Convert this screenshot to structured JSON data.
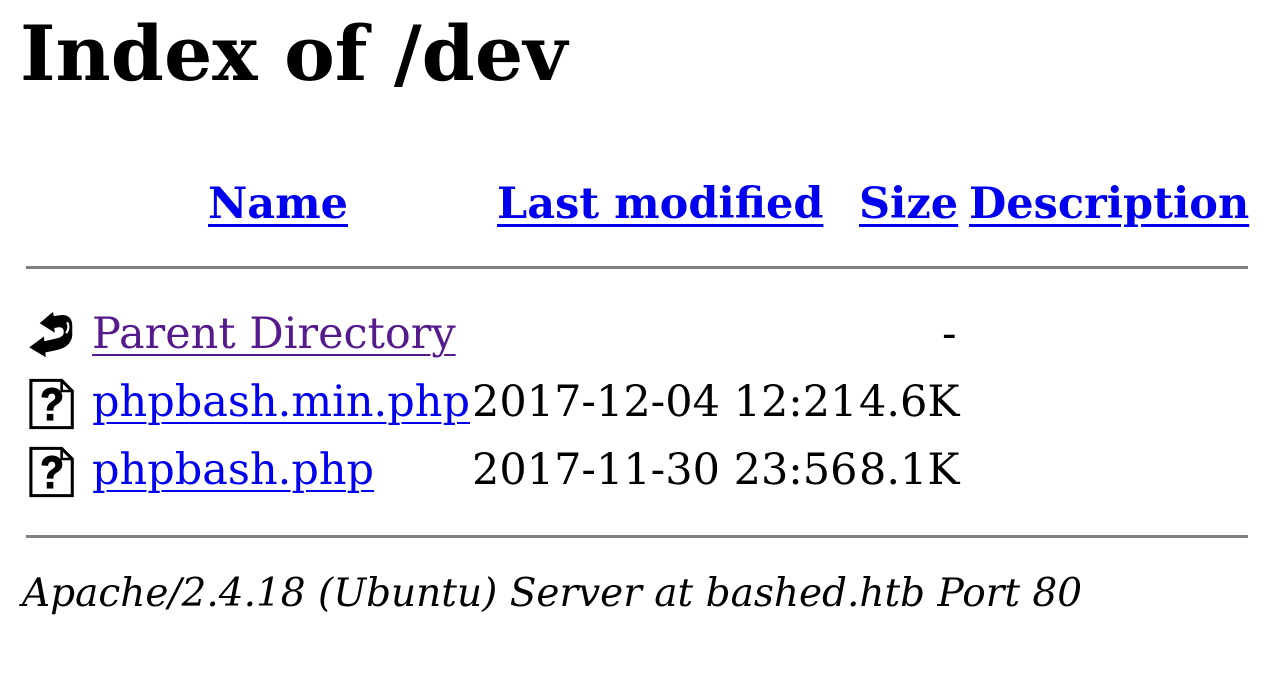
{
  "page": {
    "title": "Index of /dev"
  },
  "table": {
    "headers": {
      "name": "Name",
      "last_modified": "Last modified",
      "size": "Size",
      "description": "Description"
    },
    "rows": [
      {
        "icon": "back-arrow-icon",
        "name": "Parent Directory",
        "last_modified": "",
        "size": "-",
        "description": "",
        "visited": true
      },
      {
        "icon": "unknown-file-icon",
        "name": "phpbash.min.php",
        "last_modified": "2017-12-04 12:21",
        "size": "4.6K",
        "description": "",
        "visited": false
      },
      {
        "icon": "unknown-file-icon",
        "name": "phpbash.php",
        "last_modified": "2017-11-30 23:56",
        "size": "8.1K",
        "description": "",
        "visited": false
      }
    ]
  },
  "footer": {
    "address": "Apache/2.4.18 (Ubuntu) Server at bashed.htb Port 80"
  },
  "colors": {
    "link": "#0000ee",
    "visited_link": "#551a8b",
    "rule": "#808080"
  }
}
